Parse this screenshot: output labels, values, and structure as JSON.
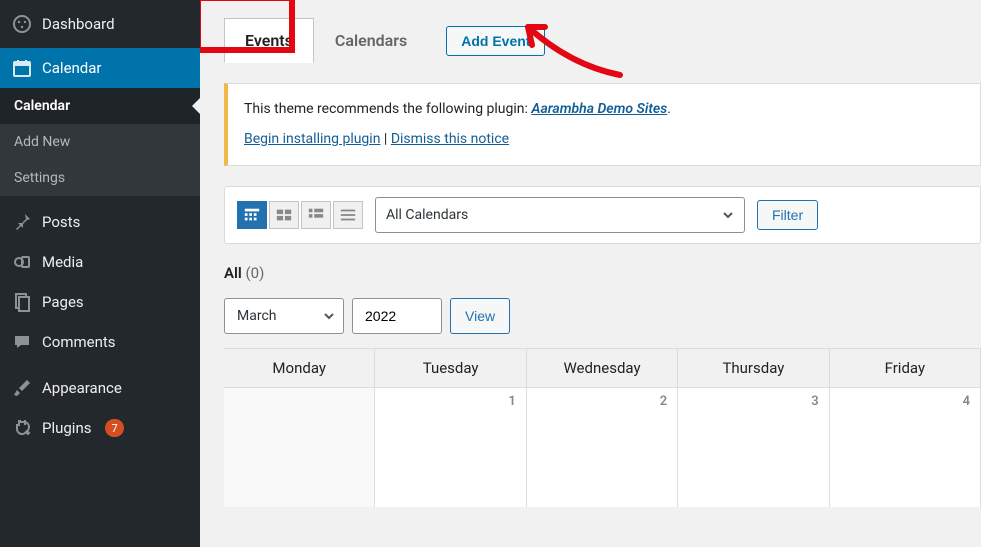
{
  "sidebar": {
    "dashboard": "Dashboard",
    "calendar": "Calendar",
    "submenu": {
      "calendar": "Calendar",
      "add_new": "Add New",
      "settings": "Settings"
    },
    "posts": "Posts",
    "media": "Media",
    "pages": "Pages",
    "comments": "Comments",
    "appearance": "Appearance",
    "plugins": "Plugins",
    "plugins_count": "7"
  },
  "tabs": {
    "events": "Events",
    "calendars": "Calendars",
    "add_event": "Add Event"
  },
  "notice": {
    "line1_a": "This theme recommends the following plugin: ",
    "line1_link": "Aarambha Demo Sites",
    "line1_b": ".",
    "link_install": "Begin installing plugin",
    "sep": " | ",
    "link_dismiss": "Dismiss this notice"
  },
  "toolbar": {
    "dropdown": "All Calendars",
    "filter": "Filter"
  },
  "allrow": {
    "label": "All",
    "count": "(0)"
  },
  "myrow": {
    "month": "March",
    "year": "2022",
    "view": "View"
  },
  "calendar": {
    "days": [
      "Monday",
      "Tuesday",
      "Wednesday",
      "Thursday",
      "Friday"
    ],
    "row1": [
      "",
      "1",
      "2",
      "3",
      "4"
    ]
  }
}
